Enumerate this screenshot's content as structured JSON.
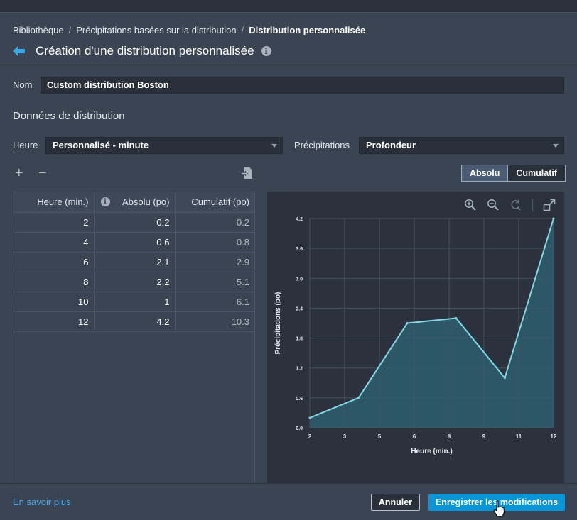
{
  "breadcrumb": {
    "items": [
      "Bibliothèque",
      "Précipitations basées sur la distribution",
      "Distribution personnalisée"
    ],
    "separator": "/"
  },
  "page": {
    "title": "Création d'une distribution personnalisée"
  },
  "form": {
    "name_label": "Nom",
    "name_value": "Custom distribution Boston",
    "section_title": "Données de distribution",
    "time_label": "Heure",
    "time_value": "Personnalisé - minute",
    "precip_label": "Précipitations",
    "precip_value": "Profondeur"
  },
  "toolbar": {
    "add": "+",
    "remove": "−"
  },
  "view_toggle": {
    "absolute": "Absolu",
    "cumulative": "Cumulatif",
    "selected": "Absolu"
  },
  "table": {
    "headers": [
      "Heure (min.)",
      "Absolu (po)",
      "Cumulatif (po)"
    ],
    "rows": [
      [
        "2",
        "0.2",
        "0.2"
      ],
      [
        "4",
        "0.6",
        "0.8"
      ],
      [
        "6",
        "2.1",
        "2.9"
      ],
      [
        "8",
        "2.2",
        "5.1"
      ],
      [
        "10",
        "1",
        "6.1"
      ],
      [
        "12",
        "4.2",
        "10.3"
      ]
    ]
  },
  "chart_data": {
    "type": "area",
    "x": [
      2,
      4,
      6,
      8,
      10,
      12
    ],
    "values": [
      0.2,
      0.6,
      2.1,
      2.2,
      1.0,
      4.2
    ],
    "xlabel": "Heure (min.)",
    "ylabel": "Précipitations (po)",
    "x_tick_labels": [
      "2",
      "3",
      "5",
      "6",
      "8",
      "9",
      "11",
      "12"
    ],
    "y_tick_labels": [
      "0.0",
      "0.6",
      "1.2",
      "1.8",
      "2.4",
      "3.0",
      "3.6",
      "4.2"
    ],
    "xlim": [
      2,
      12
    ],
    "ylim": [
      0,
      4.2
    ],
    "grid": true,
    "line_color": "#7fdbe3",
    "fill_color": "#2e5d6e"
  },
  "footer": {
    "learn_more": "En savoir plus",
    "cancel": "Annuler",
    "save": "Enregistrer les modifications"
  },
  "colors": {
    "accent": "#0696d7",
    "link": "#47a9e9",
    "background": "#3b4453"
  }
}
